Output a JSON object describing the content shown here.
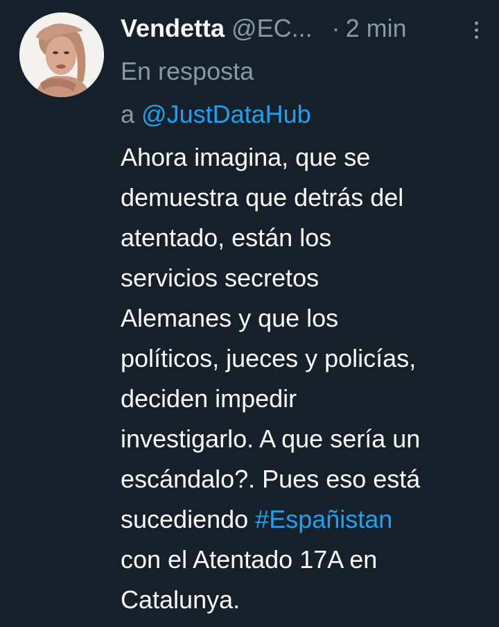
{
  "tweet": {
    "author_name": "Vendetta",
    "author_handle": "@EC...",
    "separator": "·",
    "time": "2 min",
    "avatar_icon": "profile-photo",
    "more_icon": "vertical-ellipsis-icon",
    "reply_prefix_line1": "En resposta",
    "reply_prefix_line2": "a",
    "reply_to": "@JustDataHub",
    "text_lines": [
      "Ahora imagina, que se",
      "demuestra que detrás del",
      "atentado, están los",
      "servicios secretos",
      "Alemanes y que los",
      "políticos, jueces y policías,",
      "deciden impedir",
      "investigarlo. A que sería un",
      "escándalo?. Pues eso está"
    ],
    "line10_prefix": "sucediendo",
    "hashtag": "#Españistan",
    "text_line11": "con el Atentado 17A en",
    "text_line12": "Catalunya."
  },
  "colors": {
    "background": "#15202b",
    "text": "#ffffff",
    "muted": "#8899a6",
    "accent": "#1da1f2"
  }
}
